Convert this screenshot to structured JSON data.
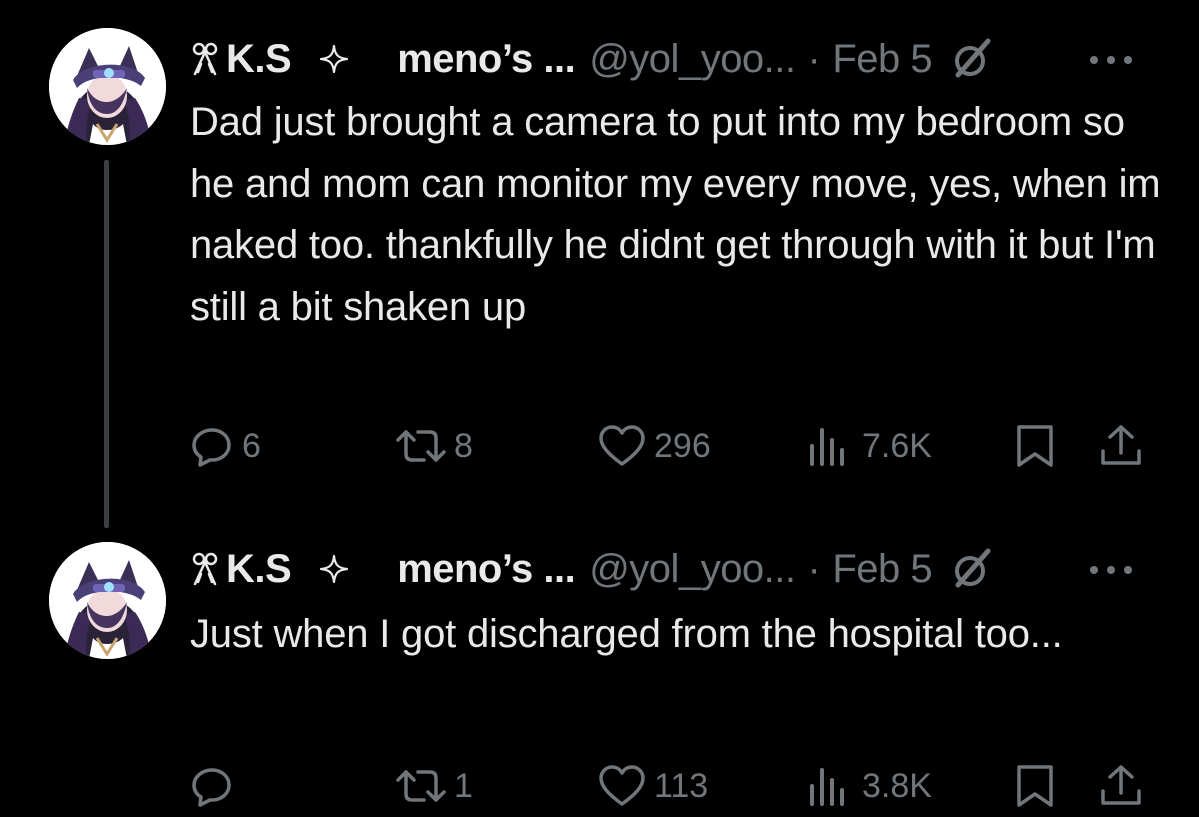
{
  "tweets": [
    {
      "display_name": "K.S",
      "community": "meno’s ...",
      "handle": "@yol_yoo...",
      "separator": "·",
      "date": "Feb 5",
      "text": "Dad just brought a camera to put into my bedroom so he and mom can monitor my every move, yes, when im naked too. thankfully he didnt get through with it but I'm still a bit shaken up",
      "replies": "6",
      "reposts": "8",
      "likes": "296",
      "views": "7.6K"
    },
    {
      "display_name": "K.S",
      "community": "meno’s ...",
      "handle": "@yol_yoo...",
      "separator": "·",
      "date": "Feb 5",
      "text": "Just when I got discharged from the hospital too...",
      "replies": "",
      "reposts": "1",
      "likes": "113",
      "views": "3.8K"
    }
  ],
  "icons": {
    "name_prefix": "bow-icon",
    "badge": "sparkle-icon",
    "community": "slash-circle-icon",
    "more": "more-dots-icon",
    "reply": "reply-icon",
    "repost": "repost-icon",
    "like": "heart-icon",
    "views": "views-chart-icon",
    "bookmark": "bookmark-icon",
    "share": "share-icon"
  },
  "colors": {
    "background": "#000000",
    "primary_text": "#e7e9ea",
    "secondary_text": "#71767b",
    "thread_line": "#3a3d41"
  }
}
